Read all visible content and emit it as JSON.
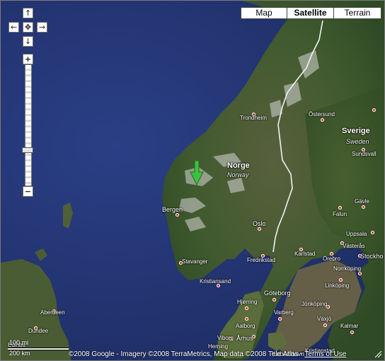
{
  "map_type_buttons": [
    {
      "label": "Map",
      "selected": false
    },
    {
      "label": "Satellite",
      "selected": true
    },
    {
      "label": "Terrain",
      "selected": false
    }
  ],
  "controls": {
    "pan_up_icon": "arrow-up-icon",
    "pan_left_icon": "arrow-left-icon",
    "pan_right_icon": "arrow-right-icon",
    "pan_down_icon": "arrow-down-icon",
    "center_icon": "pan-center-icon",
    "zoom_in_label": "+",
    "zoom_out_label": "−"
  },
  "labels": {
    "trondheim": "Trondheim",
    "ostersund": "Östersund",
    "sverige": "Sverige",
    "sweden": "Sweden",
    "sundsvall": "Sundsvall",
    "norge": "Norge",
    "norway": "Norway",
    "gavle": "Gävle",
    "falun": "Falun",
    "bergen": "Bergen",
    "oslo": "Oslo",
    "uppsala": "Uppsala",
    "vasteras": "Västerås",
    "karlstad": "Karlstad",
    "stockholm": "Stockho",
    "fredrikstad": "Fredrikstad",
    "orebro": "Örebro",
    "norrkoping": "Norrköping",
    "linkoping": "Linköping",
    "stavanger": "Stavanger",
    "kristiansand": "Kristiansand",
    "goteborg": "Göteborg",
    "hjorring": "Hjørring",
    "jonkoping": "Jönköping",
    "varberg": "Varberg",
    "vaxjo": "Växjö",
    "aalborg": "Aalborg",
    "aarhus": "Århus",
    "kalmar": "Kalmar",
    "viborg": "Viborg",
    "herning": "Herning",
    "aberdeen": "Aberdeen",
    "dundee": "Dundee",
    "kobenhavn": "København",
    "kristianstad": "Kristianstad",
    "edinburgh": "Edinbu"
  },
  "scale": {
    "imperial": "100 mi",
    "metric": "200 km"
  },
  "copyright": {
    "text": "©2008 Google - Imagery ©2008 TerraMetrics, Map data ©2008 Tele Atlas - ",
    "terms": "Terms of Use"
  },
  "colors": {
    "water": "#22336f",
    "land_green": "#3e5a2c",
    "land_brown": "#6b6040",
    "snow": "#d9d9d9",
    "border_line": "#f2f2f2",
    "marker_green": "#3fbf3f"
  }
}
